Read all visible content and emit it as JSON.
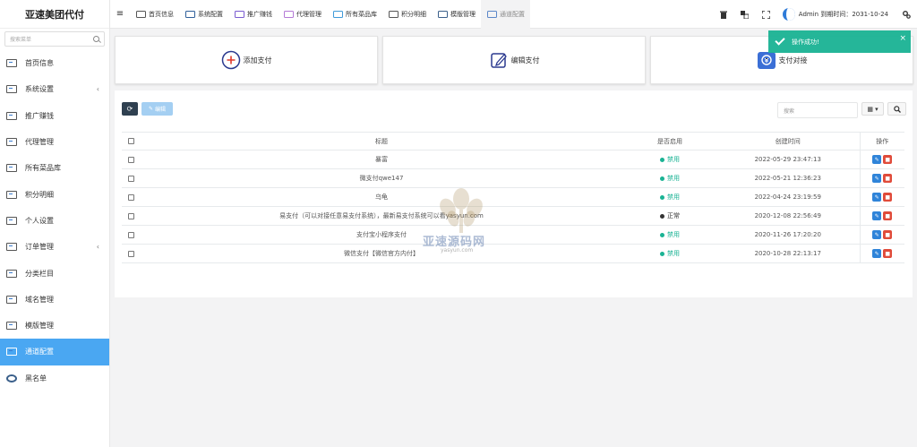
{
  "brand": "亚速美团代付",
  "sidebar": {
    "search_placeholder": "搜索菜单",
    "items": [
      {
        "label": "首页信息",
        "icon": "home-icon"
      },
      {
        "label": "系统设置",
        "icon": "settings-icon",
        "caret": "‹"
      },
      {
        "label": "推广赚钱",
        "icon": "promote-icon"
      },
      {
        "label": "代理管理",
        "icon": "agent-icon"
      },
      {
        "label": "所有菜品库",
        "icon": "dish-icon"
      },
      {
        "label": "积分明细",
        "icon": "points-icon"
      },
      {
        "label": "个人设置",
        "icon": "user-settings-icon"
      },
      {
        "label": "订单管理",
        "icon": "order-icon",
        "caret": "‹"
      },
      {
        "label": "分类栏目",
        "icon": "category-icon"
      },
      {
        "label": "域名管理",
        "icon": "domain-icon"
      },
      {
        "label": "模版管理",
        "icon": "template-icon"
      },
      {
        "label": "通道配置",
        "icon": "channel-icon",
        "active": true
      },
      {
        "label": "黑名单",
        "icon": "blacklist-icon"
      }
    ]
  },
  "topbar": {
    "menu_icon": "≡",
    "tabs": [
      "首页信息",
      "系统配置",
      "推广赚钱",
      "代理管理",
      "所有菜品库",
      "积分明细",
      "模版管理",
      "通道配置"
    ],
    "admin_text": "Admin 到期时间：2031-10-24"
  },
  "cards": [
    {
      "label": "添加支付",
      "icon": "add-circle-icon"
    },
    {
      "label": "编辑支付",
      "icon": "edit-icon"
    },
    {
      "label": "支付对接",
      "icon": "payment-icon"
    }
  ],
  "toolbar": {
    "edit_label": "编辑",
    "search_placeholder": "搜索"
  },
  "table": {
    "headers": [
      "标题",
      "是否启用",
      "创建时间",
      "操作"
    ],
    "rows": [
      {
        "title": "暴富",
        "status": "禁用",
        "created": "2022-05-29 23:47:13"
      },
      {
        "title": "微支付qwe147",
        "status": "禁用",
        "created": "2022-05-21 12:36:23"
      },
      {
        "title": "乌龟",
        "status": "禁用",
        "created": "2022-04-24 23:19:59"
      },
      {
        "title": "易支付（可以对接任意易支付系统），最新易支付系统可以看yasyun.com",
        "status": "正常",
        "created": "2020-12-08 22:56:49"
      },
      {
        "title": "支付宝小程序支付",
        "status": "禁用",
        "created": "2020-11-26 17:20:20"
      },
      {
        "title": "微信支付【微信官方内付】",
        "status": "禁用",
        "created": "2020-10-28 22:13:17"
      }
    ]
  },
  "watermark": {
    "text": "亚速源码网",
    "url": "yasyun.com"
  },
  "toast": {
    "message": "操作成功!",
    "close": "×"
  },
  "colors": {
    "active": "#4aa7f2",
    "dark": "#2f4050",
    "success": "#1ab394",
    "danger": "#e04b3a",
    "primary": "#2f84d9"
  }
}
